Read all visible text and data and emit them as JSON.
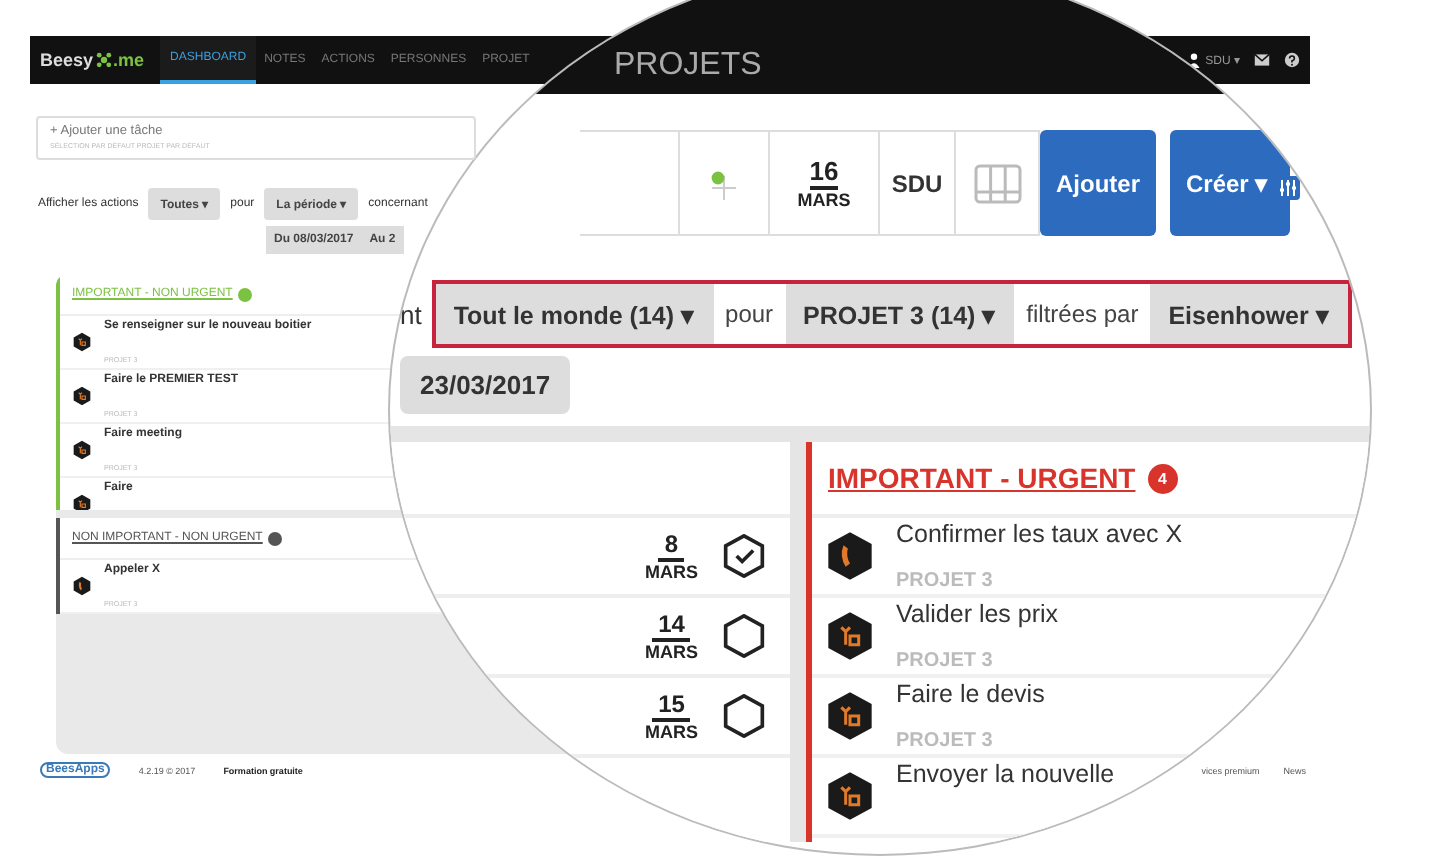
{
  "app_header": {
    "logo": {
      "left": "Beesy",
      "right": ".me"
    },
    "nav": [
      {
        "label": "DASHBOARD",
        "selected": true
      },
      {
        "label": "NOTES",
        "selected": false
      },
      {
        "label": "ACTIONS",
        "selected": false
      },
      {
        "label": "PERSONNES",
        "selected": false
      },
      {
        "label": "PROJET",
        "selected": false
      }
    ],
    "user": "SDU ▾"
  },
  "task_field": {
    "placeholder": "+ Ajouter une tâche",
    "hint": "SÉLECTION PAR DÉFAUT PROJET PAR DÉFAUT"
  },
  "filters": {
    "label": "Afficher les actions",
    "actions_dropdown": "Toutes ▾",
    "for": "pour",
    "period_dropdown": "La période ▾",
    "about": "concernant",
    "from_date": "Du 08/03/2017",
    "to_date": "Au 2"
  },
  "groups": [
    {
      "title": "IMPORTANT - NON URGENT",
      "color": "#7cc242",
      "items": [
        {
          "title": "Se renseigner sur le nouveau boitier",
          "project": "PROJET 3",
          "kind": "task"
        },
        {
          "title": "Faire le PREMIER TEST",
          "project": "PROJET 3",
          "kind": "task"
        },
        {
          "title": "Faire meeting",
          "project": "PROJET 3",
          "kind": "task"
        },
        {
          "title": "Faire",
          "kind": "task"
        }
      ]
    },
    {
      "title": "NON IMPORTANT - NON URGENT",
      "color": "#555555",
      "items": [
        {
          "title": "Appeler X",
          "project": "PROJET 3",
          "kind": "call"
        }
      ]
    }
  ],
  "footer": {
    "logo": "BeesApps",
    "version": "4.2.19 © 2017",
    "training": "Formation gratuite",
    "premium": "vices premium",
    "news": "News"
  },
  "magnifier": {
    "header_title": "PROJETS",
    "toolbar": {
      "date_day": "16",
      "date_month": "MARS",
      "user": "SDU",
      "add_button": "Ajouter",
      "create_button": "Créer ▾"
    },
    "about_tail": "nt",
    "filter_group": [
      {
        "kind": "dropdown",
        "text": "Tout le monde (14) ▾"
      },
      {
        "kind": "label",
        "text": "pour"
      },
      {
        "kind": "dropdown",
        "text": "PROJET 3 (14) ▾"
      },
      {
        "kind": "label",
        "text": "filtrées par"
      },
      {
        "kind": "dropdown",
        "text": "Eisenhower ▾"
      }
    ],
    "to_date": "23/03/2017",
    "dated_rows": [
      {
        "day": "8",
        "month": "MARS",
        "done": true
      },
      {
        "day": "14",
        "month": "MARS",
        "done": false
      },
      {
        "day": "15",
        "month": "MARS",
        "done": false
      }
    ],
    "group": {
      "title": "IMPORTANT - URGENT",
      "badge": "4",
      "color": "#d9342b",
      "items": [
        {
          "title": "Confirmer les taux avec X",
          "project": "PROJET 3",
          "kind": "call"
        },
        {
          "title": "Valider les prix",
          "project": "PROJET 3",
          "kind": "task"
        },
        {
          "title": "Faire le devis",
          "project": "PROJET 3",
          "kind": "task"
        },
        {
          "title": "Envoyer la nouvelle",
          "kind": "task"
        }
      ]
    }
  }
}
